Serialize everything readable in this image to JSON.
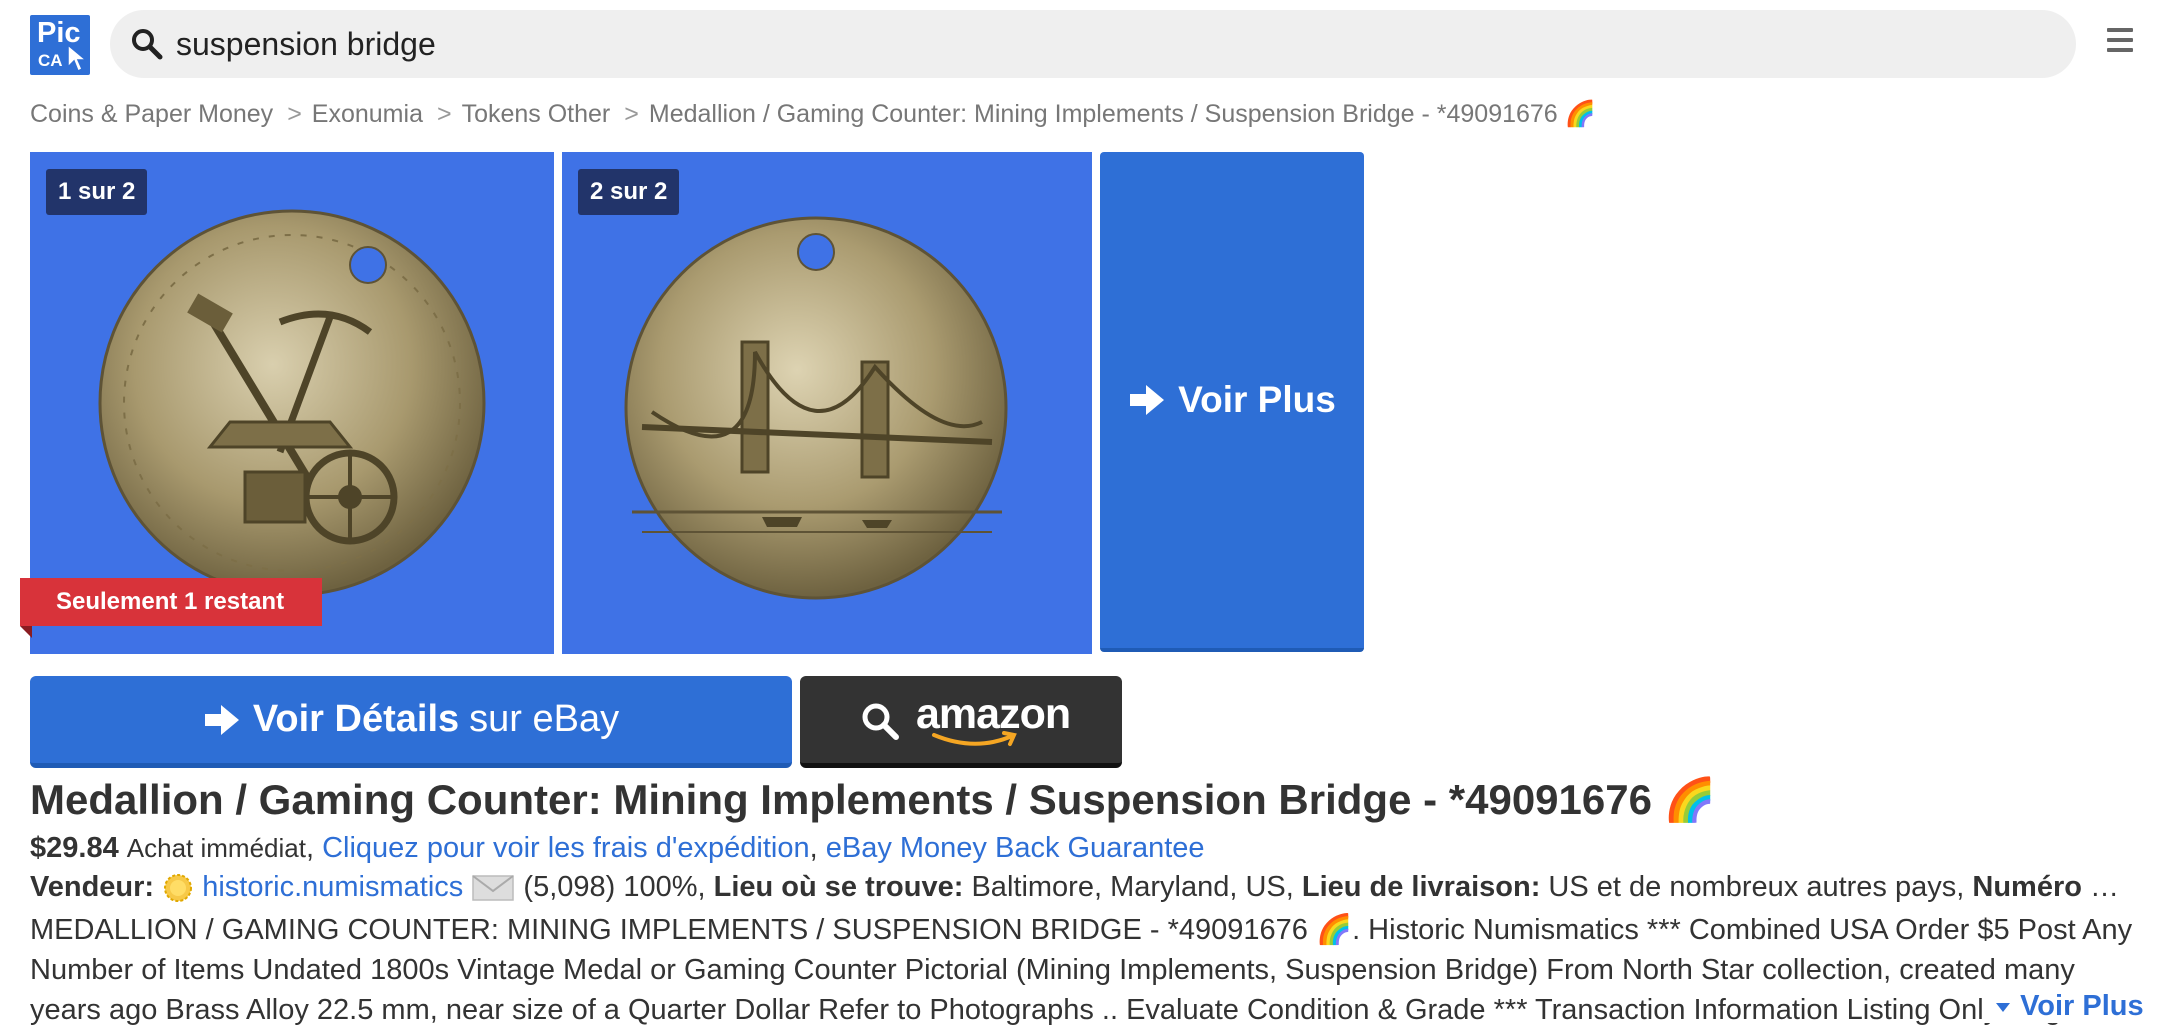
{
  "logo": {
    "line1": "Pic",
    "line2": "CA"
  },
  "search": {
    "value": "suspension bridge"
  },
  "breadcrumb": [
    "Coins & Paper Money",
    "Exonumia",
    "Tokens Other",
    "Medallion / Gaming Counter: Mining Implements / Suspension Bridge - *49091676 🌈"
  ],
  "gallery": {
    "images": [
      {
        "counter": "1 sur 2",
        "alt": "coin obverse mining implements"
      },
      {
        "counter": "2 sur 2",
        "alt": "coin reverse suspension bridge"
      }
    ],
    "more_label": "Voir Plus",
    "stock_badge": "Seulement 1 restant"
  },
  "buttons": {
    "ebay_bold": "Voir Détails",
    "ebay_rest": "sur eBay",
    "amazon": "amazon"
  },
  "listing": {
    "title": "Medallion / Gaming Counter: Mining Implements / Suspension Bridge - *49091676 🌈",
    "price": "$29.84",
    "buy_type": "Achat immédiat",
    "shipping_link": "Cliquez pour voir les frais d'expédition",
    "guarantee_link": "eBay Money Back Guarantee",
    "seller_label": "Vendeur:",
    "seller_name": "historic.numismatics",
    "seller_score": "(5,098) 100%,",
    "location_label": "Lieu où se trouve:",
    "location": "Baltimore, Maryland, US,",
    "delivery_label": "Lieu de livraison:",
    "delivery": "US et de nombreux autres pays,",
    "item_no_label": "Numéro de l'objet:",
    "description": "MEDALLION / GAMING COUNTER: MINING IMPLEMENTS / SUSPENSION BRIDGE - *49091676 🌈. Historic Numismatics *** Combined USA Order $5 Post Any Number of Items Undated 1800s Vintage Medal or Gaming Counter Pictorial (Mining Implements, Suspension Bridge) From North Star collection, created many years ago Brass Alloy 22.5 mm, near size of a Quarter Dollar Refer to Photographs .. Evaluate Condition & Grade *** Transaction Information Listing Only Original Historic",
    "more_label": "Voir Plus"
  },
  "colors": {
    "brand_blue": "#2e6fd6",
    "badge_red": "#d8333a",
    "amazon_dark": "#333333",
    "image_bg": "#3f72e6"
  }
}
